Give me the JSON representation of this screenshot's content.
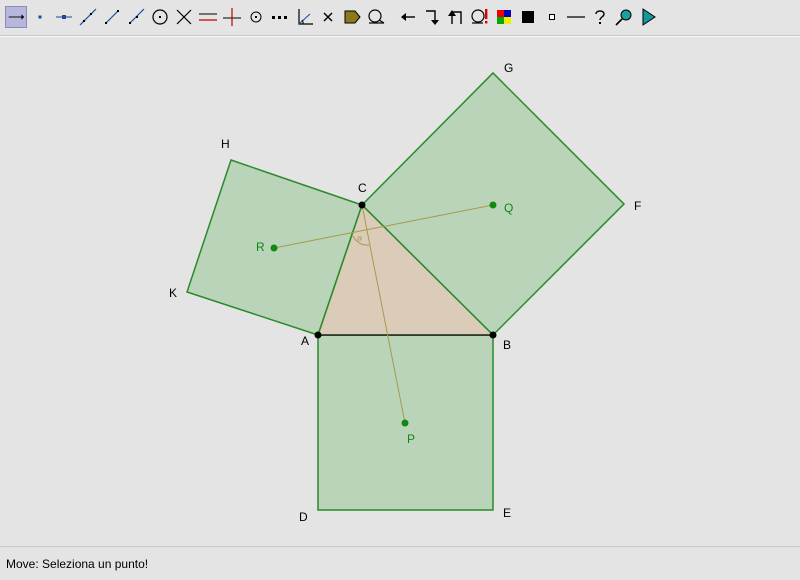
{
  "toolbar": {
    "tools": [
      {
        "icon": "move-arrow-icon",
        "active": true
      },
      {
        "icon": "point-icon"
      },
      {
        "icon": "point-on-line-icon"
      },
      {
        "icon": "line-icon"
      },
      {
        "icon": "segment-icon"
      },
      {
        "icon": "ray-icon"
      },
      {
        "icon": "circle-icon"
      },
      {
        "icon": "intersection-icon"
      },
      {
        "icon": "parallel-line-icon"
      },
      {
        "icon": "perpendicular-line-icon"
      },
      {
        "icon": "midpoint-icon"
      },
      {
        "icon": "dotted-line-icon"
      },
      {
        "icon": "angle-icon"
      },
      {
        "icon": "delete-icon"
      },
      {
        "icon": "polygon-fill-icon"
      },
      {
        "icon": "macro-icon"
      },
      {
        "icon": "undo-icon"
      },
      {
        "icon": "redo-icon"
      },
      {
        "icon": "back-icon"
      },
      {
        "icon": "alert-icon"
      },
      {
        "icon": "color-palette-icon"
      },
      {
        "icon": "filled-square-icon"
      },
      {
        "icon": "small-square-icon"
      },
      {
        "icon": "thickness-line-icon"
      },
      {
        "icon": "help-icon"
      },
      {
        "icon": "zoom-pin-icon"
      },
      {
        "icon": "play-icon"
      }
    ]
  },
  "points": {
    "A": {
      "label": "A"
    },
    "B": {
      "label": "B"
    },
    "C": {
      "label": "C"
    },
    "D": {
      "label": "D"
    },
    "E": {
      "label": "E"
    },
    "F": {
      "label": "F"
    },
    "G": {
      "label": "G"
    },
    "H": {
      "label": "H"
    },
    "K": {
      "label": "K"
    },
    "P": {
      "label": "P"
    },
    "Q": {
      "label": "Q"
    },
    "R": {
      "label": "R"
    }
  },
  "colors": {
    "square_fill": "#b9d4b8",
    "square_stroke": "#2a8a2a",
    "triangle_fill": "#d8c8b0",
    "center_line": "#a89a4a",
    "center_point": "#118811",
    "vertex_point": "#000000",
    "canvas_bg": "#e4e4e4"
  },
  "status": {
    "text": "Move: Seleziona un punto!"
  }
}
